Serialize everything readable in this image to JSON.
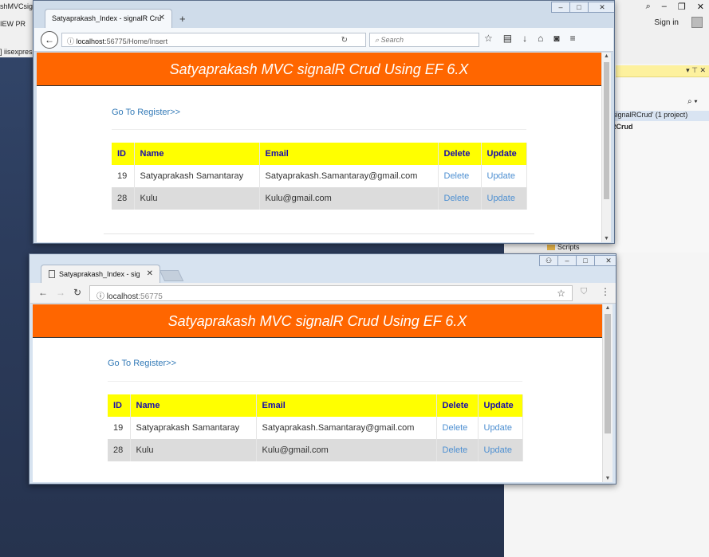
{
  "desktop": {
    "left_strip": [
      "shMVCsign",
      "IEW  PR",
      "",
      "] iisexpress"
    ],
    "vs_signin": "Sign in",
    "vs_solution": "signalRCrud' (1 project)",
    "vs_project": "RCrud",
    "vs_scripts": "Scripts"
  },
  "firefox": {
    "tab_title": "Satyaprakash_Index - signalR Cru",
    "url_host": "localhost",
    "url_path": ":56775/Home/Insert",
    "search_placeholder": "Search"
  },
  "chrome": {
    "tab_title": "Satyaprakash_Index - sig",
    "url_host": "localhost",
    "url_port": ":56775"
  },
  "page": {
    "banner": "Satyaprakash MVC signalR Crud Using EF 6.X",
    "register_link": "Go To Register>>",
    "columns": [
      "ID",
      "Name",
      "Email",
      "Delete",
      "Update"
    ],
    "rows": [
      {
        "id": "19",
        "name": "Satyaprakash Samantaray",
        "email": "Satyaprakash.Samantaray@gmail.com",
        "delete": "Delete",
        "update": "Update"
      },
      {
        "id": "28",
        "name": "Kulu",
        "email": "Kulu@gmail.com",
        "delete": "Delete",
        "update": "Update"
      }
    ]
  },
  "colors": {
    "banner_bg": "#ff6600",
    "header_bg": "#ffff00",
    "header_text": "#1a0dab",
    "link": "#337ab7"
  }
}
